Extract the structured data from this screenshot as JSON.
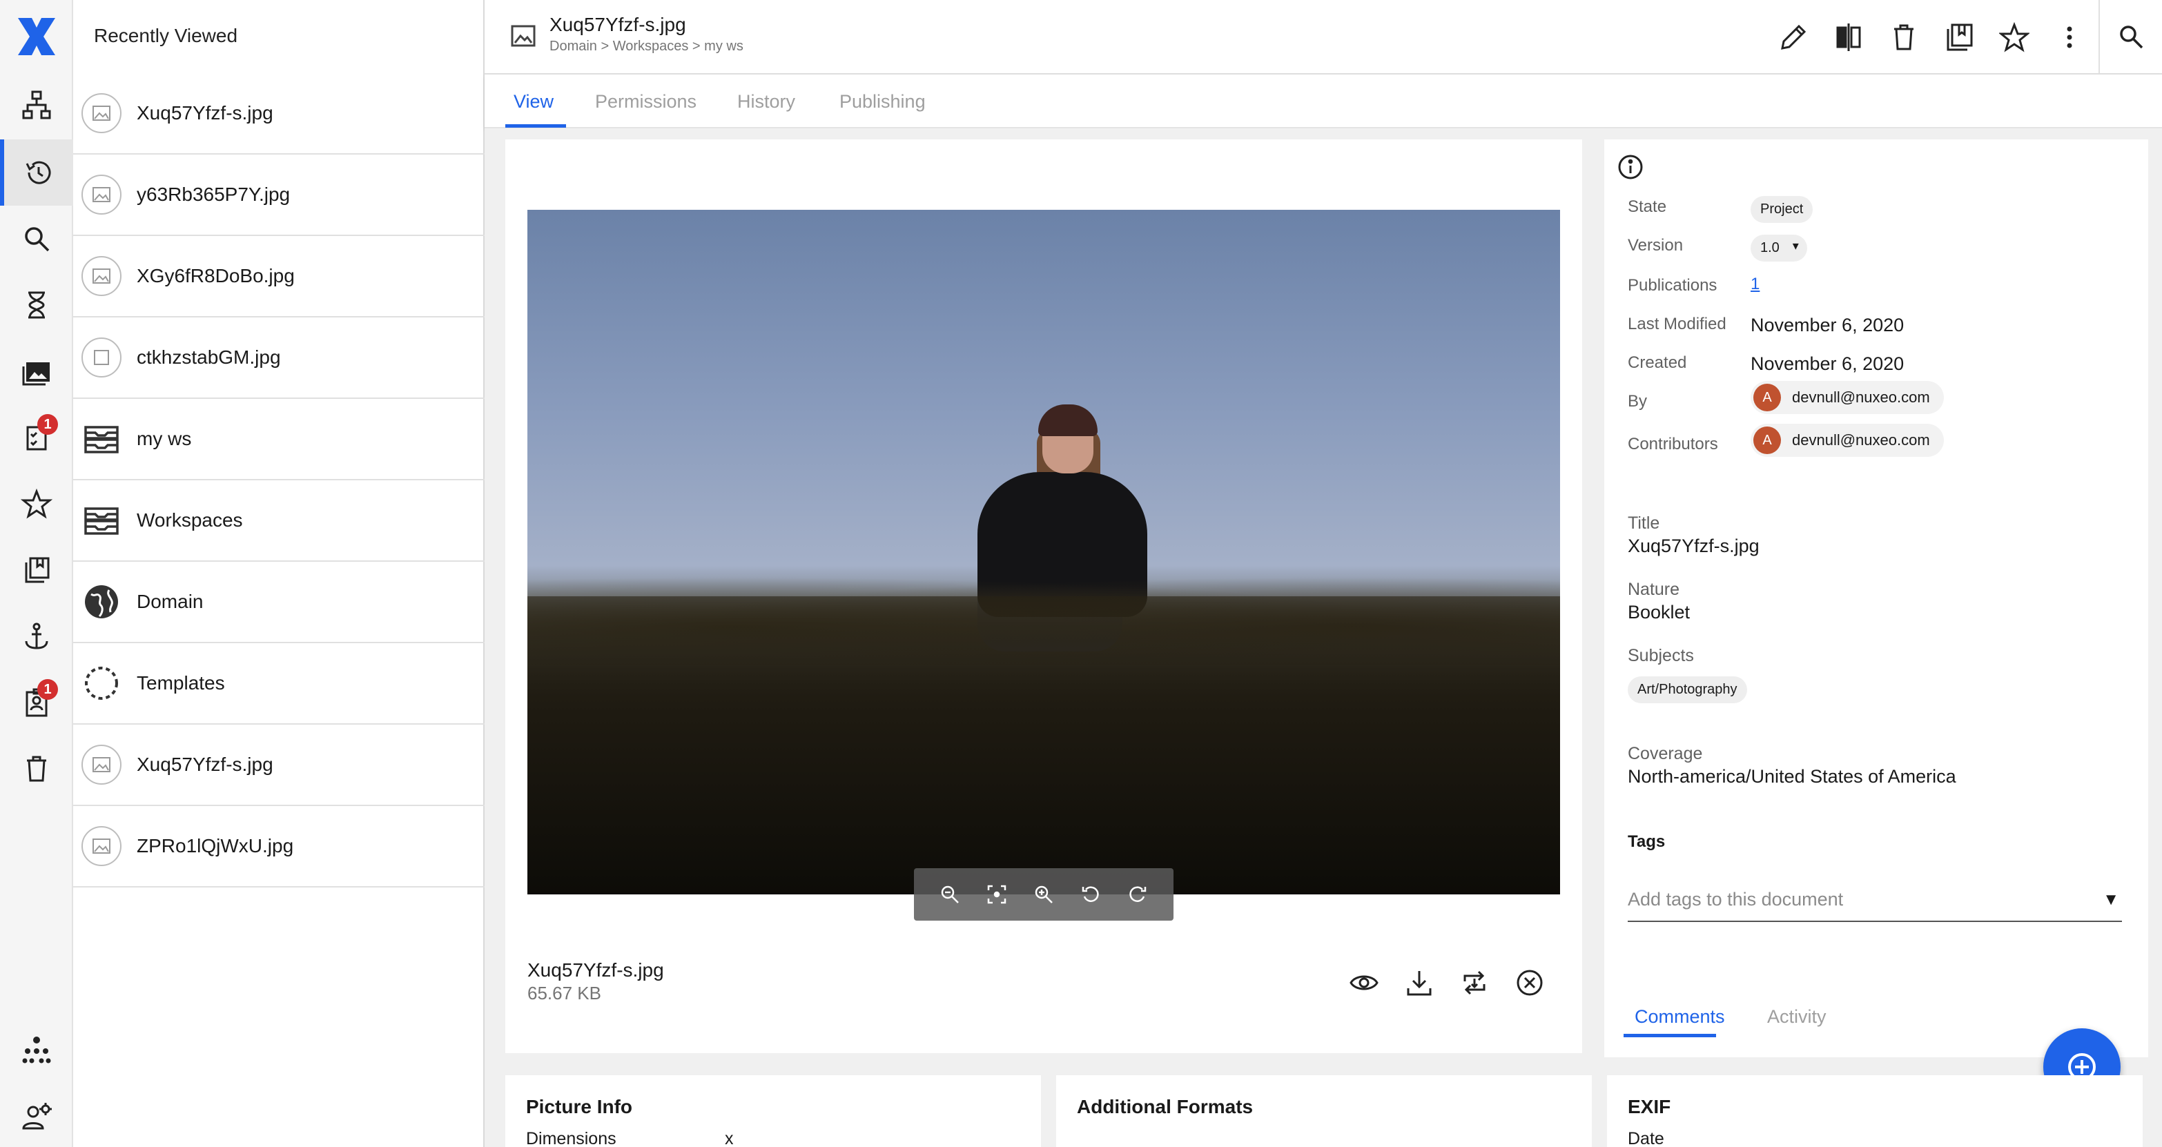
{
  "colors": {
    "accent": "#1f63e8",
    "badge": "#d32f2f",
    "avatar": "#c0522f"
  },
  "rail": {
    "logo": "nuxeo-x-logo",
    "items": [
      {
        "icon": "sitemap-icon"
      },
      {
        "icon": "history-icon",
        "active": true
      },
      {
        "icon": "search-icon"
      },
      {
        "icon": "hourglass-icon"
      },
      {
        "icon": "collections-icon"
      },
      {
        "icon": "tasks-icon",
        "badge": "1"
      },
      {
        "icon": "star-icon"
      },
      {
        "icon": "clipboard-icon"
      },
      {
        "icon": "anchor-icon"
      },
      {
        "icon": "profile-badge-icon",
        "badge": "1"
      },
      {
        "icon": "trash-icon"
      },
      {
        "icon": "admin-tree-icon"
      },
      {
        "icon": "user-settings-icon"
      }
    ],
    "badge_tasks": "1",
    "badge_profile": "1"
  },
  "drawer": {
    "title": "Recently Viewed",
    "items": [
      {
        "label": "Xuq57Yfzf-s.jpg",
        "icon": "image-icon"
      },
      {
        "label": "y63Rb365P7Y.jpg",
        "icon": "image-icon"
      },
      {
        "label": "XGy6fR8DoBo.jpg",
        "icon": "image-icon"
      },
      {
        "label": "ctkhzstabGM.jpg",
        "icon": "file-icon"
      },
      {
        "label": "my ws",
        "icon": "workspace-icon"
      },
      {
        "label": "Workspaces",
        "icon": "workspace-icon"
      },
      {
        "label": "Domain",
        "icon": "globe-icon"
      },
      {
        "label": "Templates",
        "icon": "dotted-circle-icon"
      },
      {
        "label": "Xuq57Yfzf-s.jpg",
        "icon": "image-icon"
      },
      {
        "label": "ZPRo1lQjWxU.jpg",
        "icon": "image-icon"
      }
    ]
  },
  "header": {
    "title": "Xuq57Yfzf-s.jpg",
    "breadcrumb": "Domain > Workspaces > my ws",
    "actions": [
      "edit-icon",
      "compare-icon",
      "trash-icon",
      "add-to-collection-icon",
      "star-icon",
      "more-vert-icon"
    ],
    "search_icon": "search-icon"
  },
  "tabs": {
    "view": "View",
    "permissions": "Permissions",
    "history": "History",
    "publishing": "Publishing"
  },
  "viewer": {
    "zoom_controls": [
      "zoom-out-icon",
      "fit-icon",
      "zoom-in-icon",
      "rotate-left-icon",
      "rotate-right-icon"
    ],
    "file_name": "Xuq57Yfzf-s.jpg",
    "file_size": "65.67 KB",
    "file_actions": [
      "preview-eye-icon",
      "download-icon",
      "replace-icon",
      "remove-icon"
    ]
  },
  "metadata": {
    "state_label": "State",
    "state_value": "Project",
    "version_label": "Version",
    "version_value": "1.0",
    "publications_label": "Publications",
    "publications_value": "1",
    "last_modified_label": "Last Modified",
    "last_modified_value": "November 6, 2020",
    "created_label": "Created",
    "created_value": "November 6, 2020",
    "by_label": "By",
    "by_avatar": "A",
    "by_email": "devnull@nuxeo.com",
    "contributors_label": "Contributors",
    "contributors_avatar": "A",
    "contributors_email": "devnull@nuxeo.com",
    "title_label": "Title",
    "title_value": "Xuq57Yfzf-s.jpg",
    "nature_label": "Nature",
    "nature_value": "Booklet",
    "subjects_label": "Subjects",
    "subjects_value": "Art/Photography",
    "coverage_label": "Coverage",
    "coverage_value": "North-america/United States of America",
    "tags_title": "Tags",
    "tags_placeholder": "Add tags to this document",
    "comments_tab": "Comments",
    "activity_tab": "Activity"
  },
  "bottom_cards": {
    "picture_info": "Picture Info",
    "dimensions_label": "Dimensions",
    "dimensions_value": "x",
    "additional_formats": "Additional Formats",
    "exif": "EXIF",
    "date_label": "Date"
  }
}
